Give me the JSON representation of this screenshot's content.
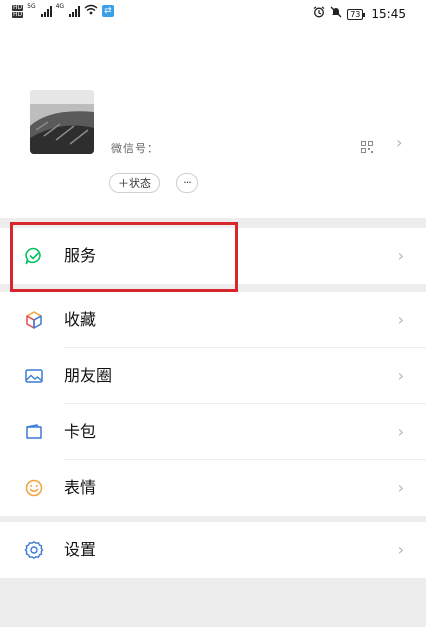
{
  "statusbar": {
    "net1": "5G",
    "net2": "4G",
    "battery": "73",
    "time": "15:45"
  },
  "profile": {
    "wxid": "微信号：",
    "status_label": "＋状态",
    "more_label": "···"
  },
  "menu": {
    "service": "服务",
    "favorites": "收藏",
    "moments": "朋友圈",
    "cards": "卡包",
    "stickers": "表情",
    "settings": "设置"
  },
  "colors": {
    "accent_green": "#07c160",
    "highlight_red": "#d7262c"
  }
}
